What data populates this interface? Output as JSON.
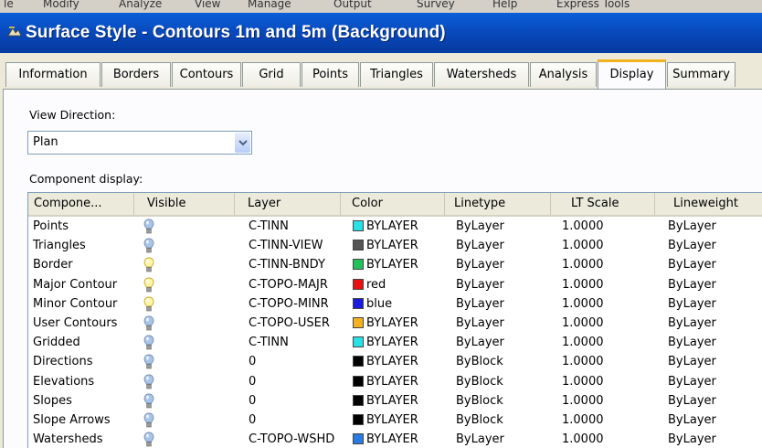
{
  "menubar": {
    "items": [
      "le",
      "Modify",
      "Analyze",
      "View",
      "Manage",
      "Output",
      "Survey",
      "Help",
      "Express Tools"
    ]
  },
  "window": {
    "title": "Surface Style - Contours 1m and 5m (Background)"
  },
  "tabs": [
    {
      "label": "Information"
    },
    {
      "label": "Borders"
    },
    {
      "label": "Contours"
    },
    {
      "label": "Grid"
    },
    {
      "label": "Points"
    },
    {
      "label": "Triangles"
    },
    {
      "label": "Watersheds"
    },
    {
      "label": "Analysis"
    },
    {
      "label": "Display",
      "active": true
    },
    {
      "label": "Summary"
    }
  ],
  "view_direction": {
    "label": "View Direction:",
    "value": "Plan"
  },
  "component_display": {
    "label": "Component display:",
    "columns": [
      "Compone...",
      "Visible",
      "Layer",
      "Color",
      "Linetype",
      "LT Scale",
      "Lineweight"
    ],
    "rows": [
      {
        "component": "Points",
        "visible": "off",
        "layer": "C-TINN",
        "color": "BYLAYER",
        "swatch": "#27e0e8",
        "linetype": "ByLayer",
        "lt_scale": "1.0000",
        "lineweight": "ByLayer"
      },
      {
        "component": "Triangles",
        "visible": "off",
        "layer": "C-TINN-VIEW",
        "color": "BYLAYER",
        "swatch": "#555555",
        "linetype": "ByLayer",
        "lt_scale": "1.0000",
        "lineweight": "ByLayer"
      },
      {
        "component": "Border",
        "visible": "on",
        "layer": "C-TINN-BNDY",
        "color": "BYLAYER",
        "swatch": "#22c05a",
        "linetype": "ByLayer",
        "lt_scale": "1.0000",
        "lineweight": "ByLayer"
      },
      {
        "component": "Major Contour",
        "visible": "on",
        "layer": "C-TOPO-MAJR",
        "color": "red",
        "swatch": "#e81010",
        "linetype": "ByLayer",
        "lt_scale": "1.0000",
        "lineweight": "ByLayer"
      },
      {
        "component": "Minor Contour",
        "visible": "on",
        "layer": "C-TOPO-MINR",
        "color": "blue",
        "swatch": "#1a1ae0",
        "linetype": "ByLayer",
        "lt_scale": "1.0000",
        "lineweight": "ByLayer"
      },
      {
        "component": "User Contours",
        "visible": "off",
        "layer": "C-TOPO-USER",
        "color": "BYLAYER",
        "swatch": "#f5b020",
        "linetype": "ByLayer",
        "lt_scale": "1.0000",
        "lineweight": "ByLayer"
      },
      {
        "component": "Gridded",
        "visible": "off",
        "layer": "C-TINN",
        "color": "BYLAYER",
        "swatch": "#27e0e8",
        "linetype": "ByLayer",
        "lt_scale": "1.0000",
        "lineweight": "ByLayer"
      },
      {
        "component": "Directions",
        "visible": "off",
        "layer": "0",
        "color": "BYLAYER",
        "swatch": "#000000",
        "linetype": "ByBlock",
        "lt_scale": "1.0000",
        "lineweight": "ByLayer"
      },
      {
        "component": "Elevations",
        "visible": "off",
        "layer": "0",
        "color": "BYLAYER",
        "swatch": "#000000",
        "linetype": "ByBlock",
        "lt_scale": "1.0000",
        "lineweight": "ByLayer"
      },
      {
        "component": "Slopes",
        "visible": "off",
        "layer": "0",
        "color": "BYLAYER",
        "swatch": "#000000",
        "linetype": "ByBlock",
        "lt_scale": "1.0000",
        "lineweight": "ByLayer"
      },
      {
        "component": "Slope Arrows",
        "visible": "off",
        "layer": "0",
        "color": "BYLAYER",
        "swatch": "#000000",
        "linetype": "ByBlock",
        "lt_scale": "1.0000",
        "lineweight": "ByLayer"
      },
      {
        "component": "Watersheds",
        "visible": "off",
        "layer": "C-TOPO-WSHD",
        "color": "BYLAYER",
        "swatch": "#2a7ae0",
        "linetype": "ByLayer",
        "lt_scale": "1.0000",
        "lineweight": "ByLayer"
      }
    ]
  },
  "icons": {
    "bulb_on": "lightbulb-on-icon",
    "bulb_off": "lightbulb-off-icon",
    "dropdown": "chevron-down-icon"
  },
  "colors": {
    "title_bar": "#0846b8",
    "tab_highlight": "#f5b41e",
    "bulb_on": "#fff4a8",
    "bulb_off": "#a9c4e6"
  }
}
